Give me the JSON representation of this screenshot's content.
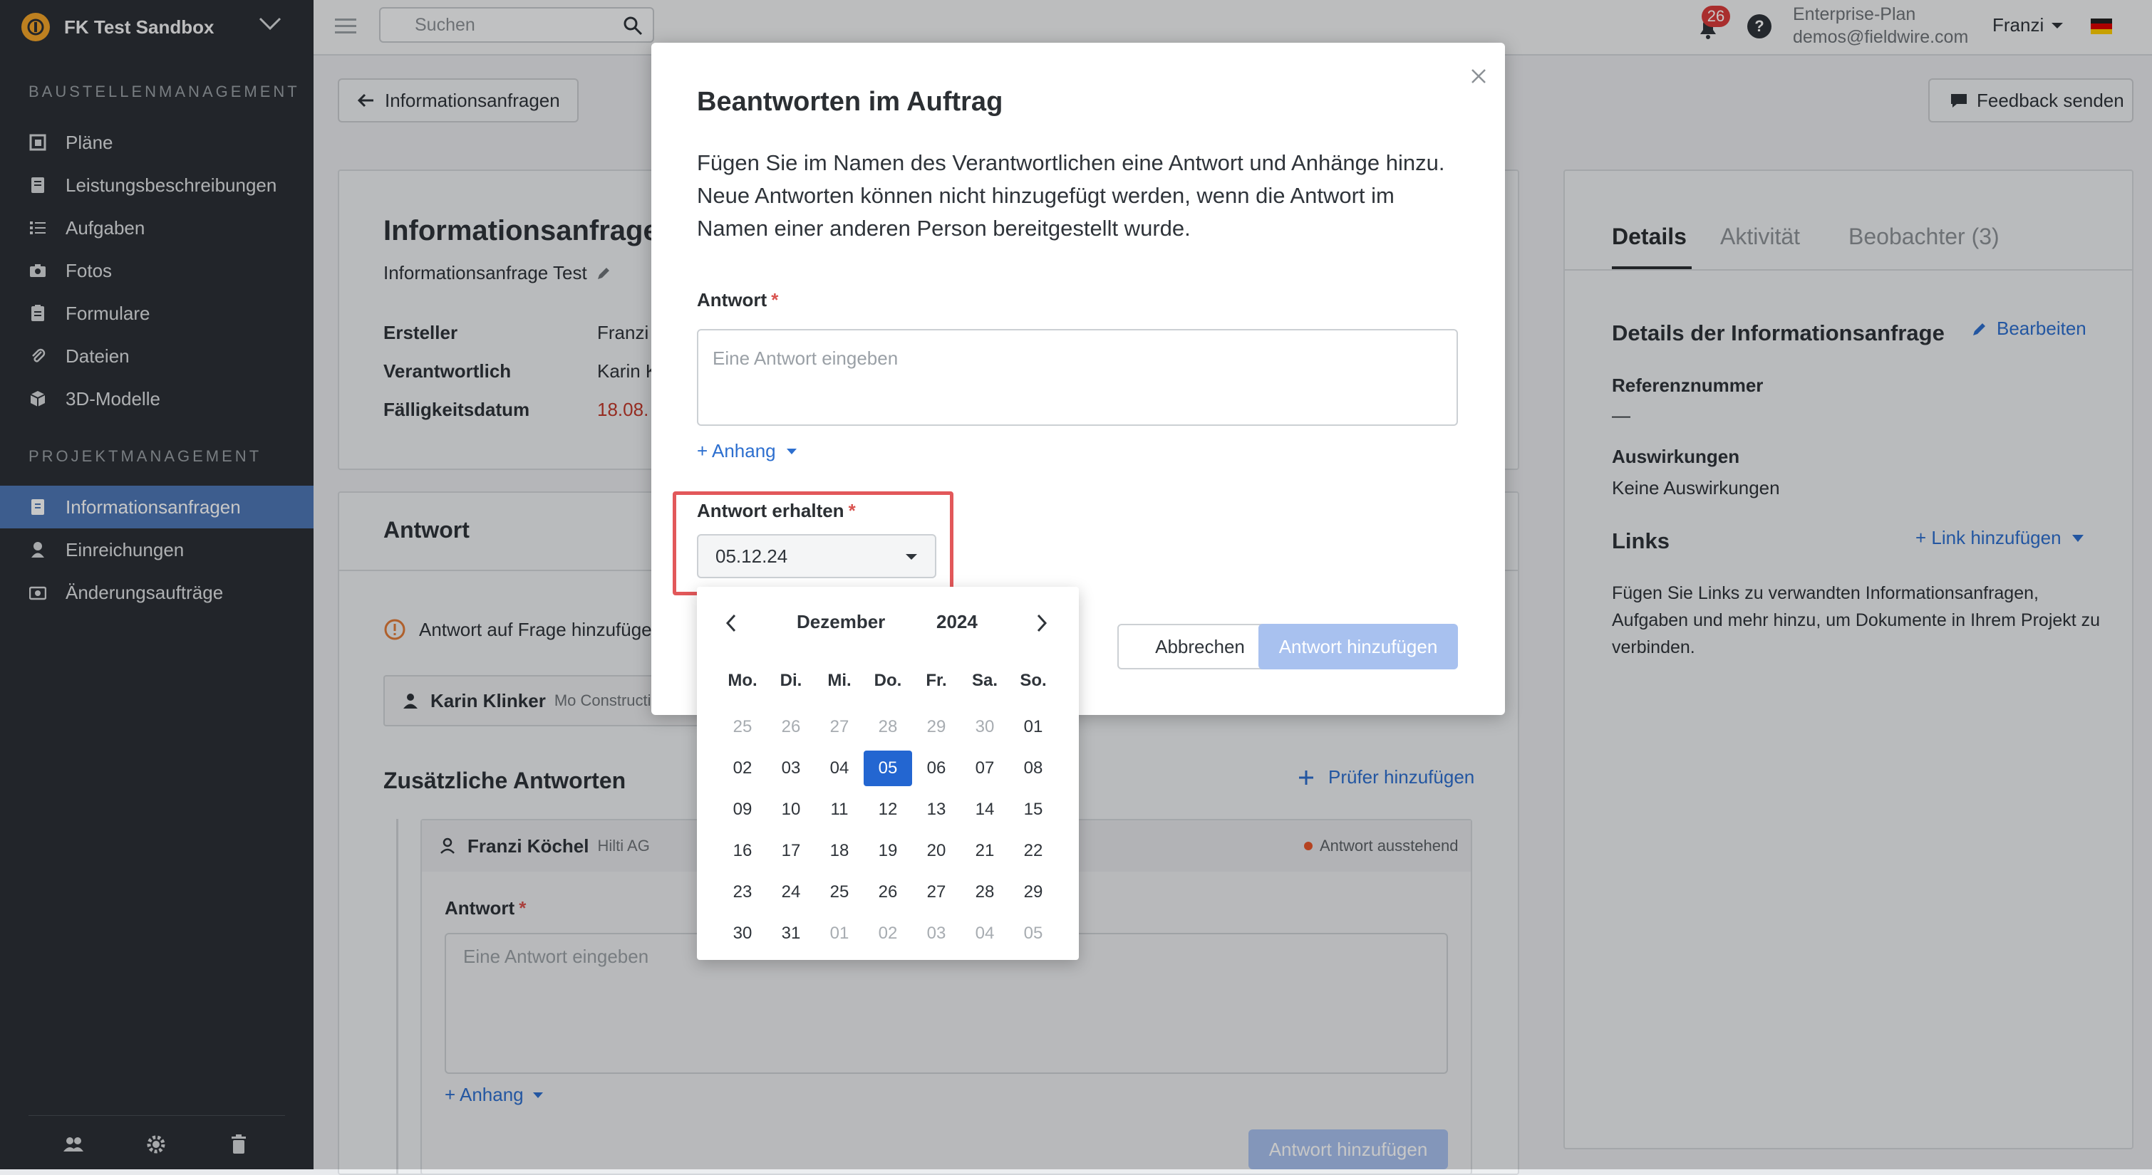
{
  "sidebar": {
    "project": "FK Test Sandbox",
    "section1": "BAUSTELLENMANAGEMENT",
    "section2": "PROJEKTMANAGEMENT",
    "items": [
      {
        "label": "Pläne",
        "icon": "plans-icon"
      },
      {
        "label": "Leistungsbeschreibungen",
        "icon": "specs-icon"
      },
      {
        "label": "Aufgaben",
        "icon": "tasks-icon"
      },
      {
        "label": "Fotos",
        "icon": "camera-icon"
      },
      {
        "label": "Formulare",
        "icon": "forms-icon"
      },
      {
        "label": "Dateien",
        "icon": "paperclip-icon"
      },
      {
        "label": "3D-Modelle",
        "icon": "cube-icon"
      },
      {
        "label": "Informationsanfragen",
        "icon": "rfi-icon"
      },
      {
        "label": "Einreichungen",
        "icon": "submittals-icon"
      },
      {
        "label": "Änderungsaufträge",
        "icon": "change-orders-icon"
      }
    ]
  },
  "topbar": {
    "search_placeholder": "Suchen",
    "notification_count": "26",
    "plan": "Enterprise-Plan",
    "email": "demos@fieldwire.com",
    "user": "Franzi"
  },
  "page": {
    "back_label": "Informationsanfragen",
    "feedback_label": "Feedback senden",
    "title": "Informationsanfrage",
    "subtitle": "Informationsanfrage Test",
    "fields": [
      {
        "label": "Ersteller",
        "value": "Franzi"
      },
      {
        "label": "Verantwortlich",
        "value": "Karin K"
      },
      {
        "label": "Fälligkeitsdatum",
        "value": "18.08."
      }
    ],
    "answer_heading": "Antwort",
    "question_notice": "Antwort auf Frage hinzufüge",
    "responder_name": "Karin Klinker",
    "responder_company": "Mo Constructio",
    "additional_heading": "Zusätzliche Antworten",
    "add_reviewer": "Prüfer hinzufügen",
    "reviewer_name": "Franzi Köchel",
    "reviewer_company": "Hilti AG",
    "reviewer_status": "Antwort ausstehend",
    "inner_answer_label": "Antwort",
    "inner_placeholder": "Eine Antwort eingeben",
    "inner_attach": "+ Anhang",
    "inner_submit": "Antwort hinzufügen"
  },
  "right_panel": {
    "tabs": [
      "Details",
      "Aktivität",
      "Beobachter (3)"
    ],
    "details_heading": "Details der Informationsanfrage",
    "edit_label": "Bearbeiten",
    "ref_label": "Referenznummer",
    "ref_value": "—",
    "impact_label": "Auswirkungen",
    "impact_value": "Keine Auswirkungen",
    "links_heading": "Links",
    "add_link": "+ Link hinzufügen",
    "links_desc": "Fügen Sie Links zu verwandten Informationsanfragen, Aufgaben und mehr hinzu, um Dokumente in Ihrem Projekt zu verbinden."
  },
  "modal": {
    "title": "Beantworten im Auftrag",
    "description": "Fügen Sie im Namen des Verantwortlichen eine Antwort und Anhänge hinzu. Neue Antworten können nicht hinzugefügt werden, wenn die Antwort im Namen einer anderen Person bereitgestellt wurde.",
    "answer_label": "Antwort",
    "answer_placeholder": "Eine Antwort eingeben",
    "attach_label": "+ Anhang",
    "received_label": "Antwort erhalten",
    "date_value": "05.12.24",
    "cancel_label": "Abbrechen",
    "submit_label": "Antwort hinzufügen"
  },
  "calendar": {
    "month": "Dezember",
    "year": "2024",
    "weekdays": [
      "Mo.",
      "Di.",
      "Mi.",
      "Do.",
      "Fr.",
      "Sa.",
      "So."
    ],
    "weeks": [
      [
        "25",
        "26",
        "27",
        "28",
        "29",
        "30",
        "01"
      ],
      [
        "02",
        "03",
        "04",
        "05",
        "06",
        "07",
        "08"
      ],
      [
        "09",
        "10",
        "11",
        "12",
        "13",
        "14",
        "15"
      ],
      [
        "16",
        "17",
        "18",
        "19",
        "20",
        "21",
        "22"
      ],
      [
        "23",
        "24",
        "25",
        "26",
        "27",
        "28",
        "29"
      ],
      [
        "30",
        "31",
        "01",
        "02",
        "03",
        "04",
        "05"
      ]
    ],
    "selected": "05"
  },
  "colors": {
    "sidebar_bg": "#2c3036",
    "active_nav": "#4f78b7",
    "accent_blue": "#2d6fcf",
    "selected_day": "#2366d1",
    "highlight_red": "#e2585a",
    "due_red": "#c0392b"
  }
}
